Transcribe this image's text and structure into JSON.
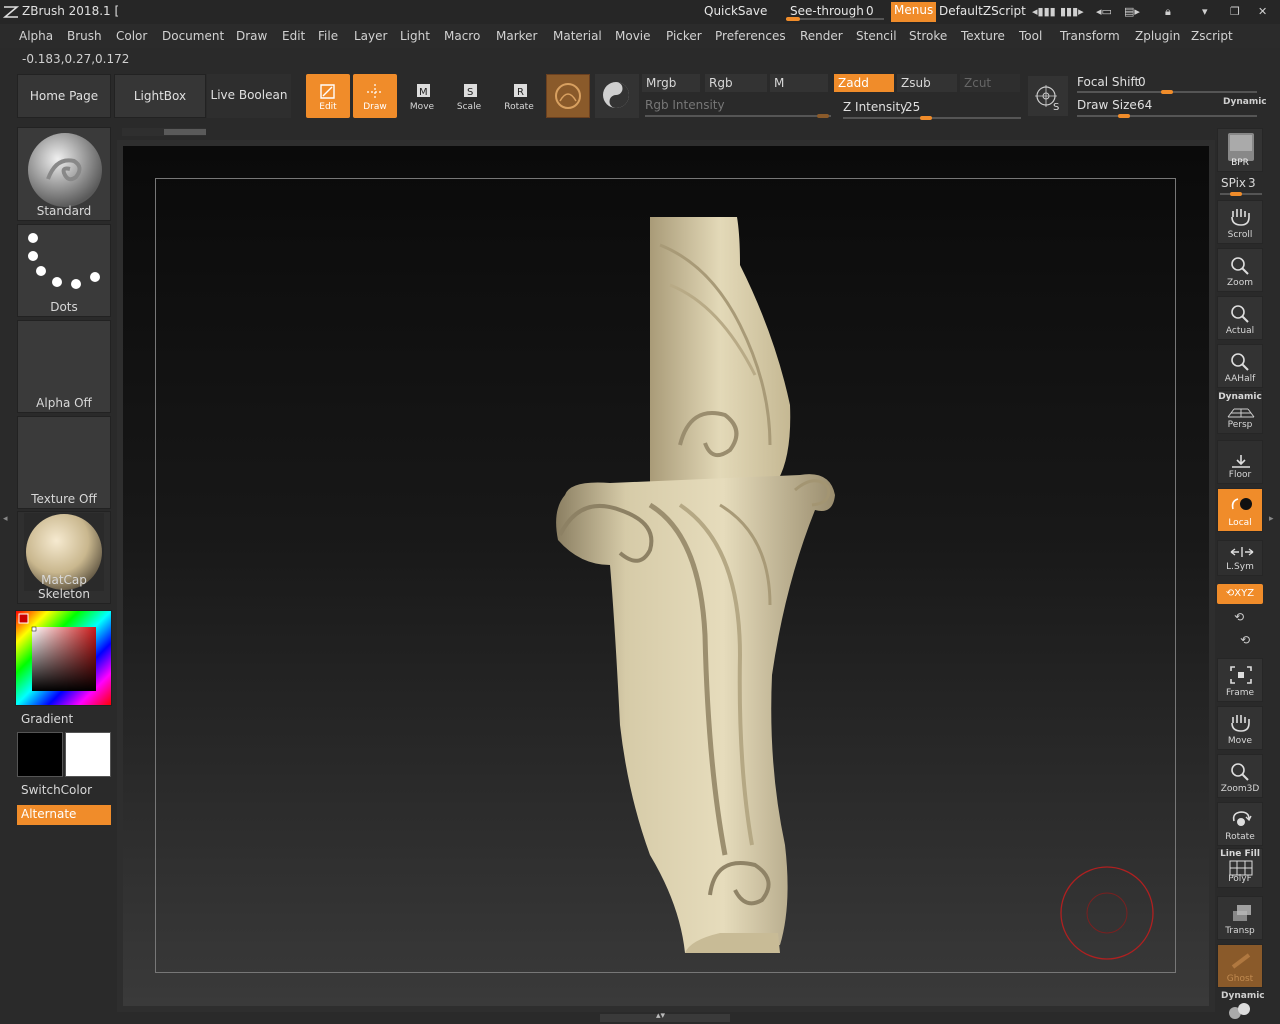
{
  "titlebar": {
    "app_title": "ZBrush 2018.1 [",
    "quicksave": "QuickSave",
    "see_through_label": "See-through",
    "see_through_value": "0",
    "menus": "Menus",
    "default_zscript": "DefaultZScript"
  },
  "menu": [
    "Alpha",
    "Brush",
    "Color",
    "Document",
    "Draw",
    "Edit",
    "File",
    "Layer",
    "Light",
    "Macro",
    "Marker",
    "Material",
    "Movie",
    "Picker",
    "Preferences",
    "Render",
    "Stencil",
    "Stroke",
    "Texture",
    "Tool",
    "Transform",
    "Zplugin",
    "Zscript"
  ],
  "coords": "-0.183,0.27,0.172",
  "shelf": {
    "home_page": "Home Page",
    "lightbox": "LightBox",
    "live_boolean": "Live Boolean",
    "edit": "Edit",
    "draw": "Draw",
    "move": "Move",
    "scale": "Scale",
    "rotate": "Rotate",
    "mrgb": "Mrgb",
    "rgb": "Rgb",
    "m": "M",
    "zadd": "Zadd",
    "zsub": "Zsub",
    "zcut": "Zcut",
    "rgb_intensity": "Rgb Intensity",
    "z_intensity_label": "Z Intensity",
    "z_intensity_value": "25",
    "focal_shift_label": "Focal Shift",
    "focal_shift_value": "0",
    "draw_size_label": "Draw Size",
    "draw_size_value": "64",
    "dynamic": "Dynamic"
  },
  "left_panel": {
    "brush": "Standard",
    "stroke": "Dots",
    "alpha": "Alpha Off",
    "texture": "Texture Off",
    "material": "MatCap Skeleton",
    "gradient": "Gradient",
    "switch_color": "SwitchColor",
    "alternate": "Alternate"
  },
  "right_panel": {
    "bpr": "BPR",
    "spix_label": "SPix",
    "spix_value": "3",
    "scroll": "Scroll",
    "zoom": "Zoom",
    "actual": "Actual",
    "aahalf": "AAHalf",
    "dynamic": "Dynamic",
    "persp": "Persp",
    "floor": "Floor",
    "local": "Local",
    "lsym": "L.Sym",
    "xyz": "XYZ",
    "frame": "Frame",
    "move": "Move",
    "zoom3d": "Zoom3D",
    "rotate": "Rotate",
    "line_fill": "Line Fill",
    "polyf": "PolyF",
    "transp": "Transp",
    "ghost": "Ghost",
    "dynamic2": "Dynamic"
  },
  "colors": {
    "accent": "#f08c2a",
    "model": "#d8ccaa",
    "brush_circle": "#b02020"
  }
}
